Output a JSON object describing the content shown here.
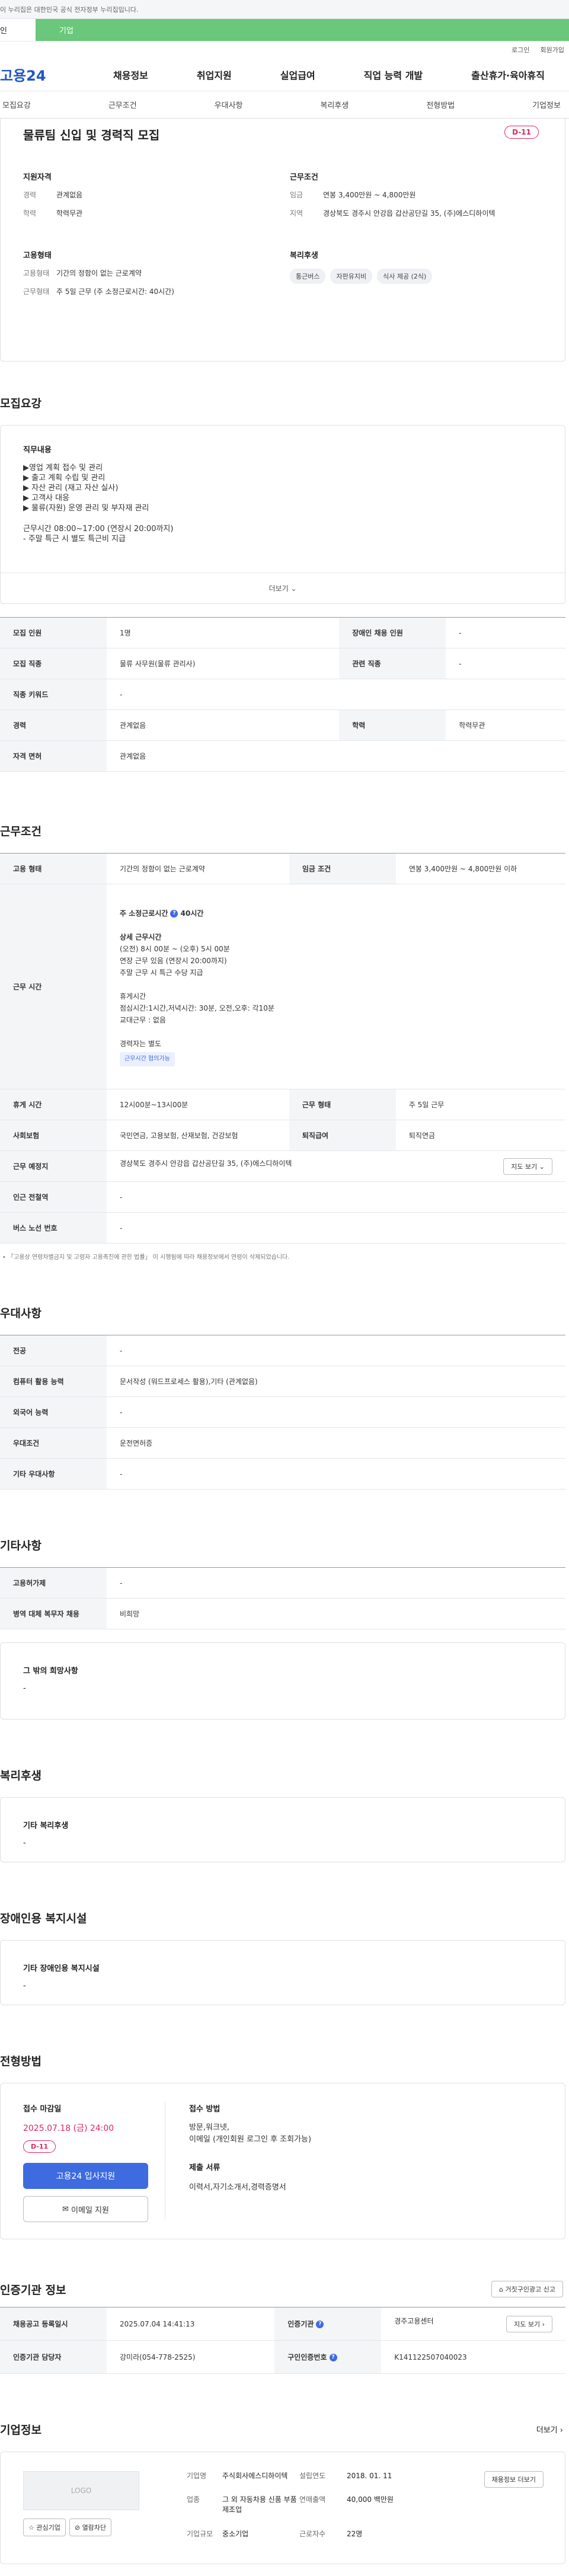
{
  "gov_notice": "이 누리집은 대한민국 공식 전자정부 누리집입니다.",
  "env": {
    "left": "인",
    "right": "기업"
  },
  "utility": {
    "login": "로그인",
    "join": "회원가입"
  },
  "logo": {
    "text": "고용24"
  },
  "gnb": [
    "채용정보",
    "취업지원",
    "실업급여",
    "직업 능력 개발",
    "출산휴가·육아휴직"
  ],
  "tabs": [
    "모집요강",
    "근무조건",
    "우대사항",
    "복리후생",
    "전형방법",
    "기업정보"
  ],
  "summary": {
    "title": "물류팀 신입 및 경력직 모집",
    "dday": "D-11",
    "qual_title": "지원자격",
    "qual": [
      {
        "k": "경력",
        "v": "관계없음"
      },
      {
        "k": "학력",
        "v": "학력무관"
      }
    ],
    "work_title": "근무조건",
    "work": [
      {
        "k": "임금",
        "v": "연봉 3,400만원 ~ 4,800만원"
      },
      {
        "k": "지역",
        "v": "경상북도 경주시 안강읍 갑산공단길 35, (주)에스디하이텍"
      }
    ],
    "emp_title": "고용형태",
    "emp": [
      {
        "k": "고용형태",
        "v": "기간의 정함이 없는 근로계약"
      },
      {
        "k": "근무형태",
        "v": "주 5일 근무 (주 소정근로시간: 40시간)"
      }
    ],
    "welfare_title": "복리후생",
    "welfare": [
      "통근버스",
      "자판유지비",
      "식사 제공 (2식)"
    ]
  },
  "recruit": {
    "section": "모집요강",
    "duty_title": "직무내용",
    "duty_lines": [
      "▶영업 계획 접수 및 관리",
      "▶ 출고 계획 수립 및 관리",
      "▶ 자산 관리 (재고 자산 실사)",
      "▶ 고객사 대응",
      "▶ 물류(자원) 운영 관리 및 부자재 관리"
    ],
    "hours_lines": [
      "근무시간 08:00~17:00 (연장시 20:00까지)",
      "- 주말 특근 시 별도 특근비 지급"
    ],
    "more": "더보기",
    "rows": [
      [
        "모집 인원",
        "1명",
        "장애인 채용 인원",
        "-"
      ],
      [
        "모집 직종",
        "물류 사무원(물류 관리사)",
        "관련 직종",
        "-"
      ],
      [
        "직종 키워드",
        "-",
        "",
        ""
      ],
      [
        "경력",
        "관계없음",
        "학력",
        "학력무관"
      ],
      [
        "자격 면허",
        "관계없음",
        "",
        ""
      ]
    ]
  },
  "conditions": {
    "section": "근무조건",
    "emp_type_k": "고용 형태",
    "emp_type_v": "기간의 정함이 없는 근로계약",
    "wage_k": "임금 조건",
    "wage_v": "연봉 3,400만원 ~ 4,800만원 이하",
    "time_k": "근무 시간",
    "time_head": "주 소정근로시간",
    "time_hours": "40시간",
    "time_detail_title": "상세 근무시간",
    "time_detail": [
      "(오전) 8시 00분 ~ (오후) 5시 00분",
      "연장 근무 있음 (연장시 20:00까지)",
      "주말 근무 시 특근 수당 지급"
    ],
    "break_title": "휴게시간",
    "break_line": "점심시간:1시간,저녁시간: 30분, 오전,오후: 각10분",
    "shift_note": "교대근무 : 없음",
    "flex_line": "경력자는 별도",
    "flex_tag": "근무시간 협의가능",
    "rows": [
      [
        "휴게 시간",
        "12시00분~13시00분",
        "근무 형태",
        "주 5일 근무"
      ],
      [
        "사회보험",
        "국민연금, 고용보험, 산재보험, 건강보험",
        "퇴직급여",
        "퇴직연금"
      ]
    ],
    "place_k": "근무 예정지",
    "place_v": "경상북도 경주시 안강읍 갑산공단길 35, (주)에스디하이텍",
    "map_btn": "지도 보기",
    "station_k": "인근 전철역",
    "station_v": "-",
    "bus_k": "버스 노선 번호",
    "bus_v": "-",
    "note": "「고용상 연령차별금지 및 고령자 고용촉진에 관한 법률」 이 시행됨에 따라 채용정보에서 연령이 삭제되었습니다."
  },
  "preference": {
    "section": "우대사항",
    "rows": [
      [
        "전공",
        "-"
      ],
      [
        "컴퓨터 활용 능력",
        "문서작성 (워드프로세스 활용),기타 (관계없음)"
      ],
      [
        "외국어 능력",
        "-"
      ],
      [
        "우대조건",
        "운전면허증"
      ],
      [
        "기타 우대사항",
        "-"
      ]
    ]
  },
  "etc": {
    "section": "기타사항",
    "rows": [
      [
        "고용허가제",
        "-"
      ],
      [
        "병역 대체 복무자 채용",
        "비희망"
      ]
    ],
    "other_title": "그 밖의 희망사항",
    "other_value": "-"
  },
  "benefits": {
    "section": "복리후생",
    "title": "기타 복리후생",
    "value": "-"
  },
  "disability": {
    "section": "장애인용 복지시설",
    "title": "기타 장애인용 복지시설",
    "value": "-"
  },
  "screening": {
    "section": "전형방법",
    "deadline_title": "접수 마감일",
    "deadline": "2025.07.18 (금) 24:00",
    "dday": "D-11",
    "apply_btn": "고용24 입사지원",
    "email_btn": "이메일 지원",
    "method_title": "접수 방법",
    "methods": [
      "방문,워크넷,",
      "이메일 (개인회원 로그인 후 조회가능)"
    ],
    "docs_title": "제출 서류",
    "docs": "이력서,자기소개서,경력증명서"
  },
  "certification": {
    "section": "인증기관 정보",
    "report_btn": "거짓구인광고 신고",
    "posted_k": "채용공고 등록일시",
    "posted_v": "2025.07.04 14:41:13",
    "agency_k": "인증기관",
    "agency_v": "경주고용센터",
    "map_btn": "지도 보기",
    "manager_k": "인증기관 담당자",
    "manager_v": "강미라(054-778-2525)",
    "id_k": "구인인증번호",
    "id_v": "K141122507040023"
  },
  "company": {
    "section": "기업정보",
    "more": "더보기",
    "logo": "LOGO",
    "interest_btn": "관심기업",
    "block_btn": "열람차단",
    "info_btn": "채용정보 더보기",
    "fields": [
      {
        "k": "기업명",
        "v": "주식회사에스디하이텍"
      },
      {
        "k": "설립연도",
        "v": "2018. 01. 11"
      },
      {
        "k": "업종",
        "v": "그 외 자동차용 신품 부품 제조업"
      },
      {
        "k": "연매출액",
        "v": "40,000 백만원"
      },
      {
        "k": "기업규모",
        "v": "중소기업"
      },
      {
        "k": "근로자수",
        "v": "22명"
      }
    ]
  }
}
